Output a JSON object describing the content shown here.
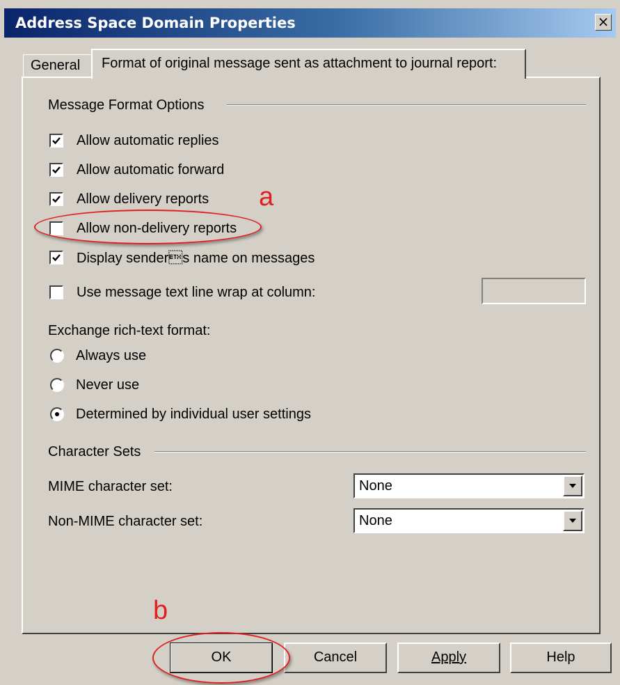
{
  "window": {
    "title": "Address Space Domain Properties",
    "close_glyph": "×"
  },
  "tabs": [
    {
      "label": "General",
      "active": false
    },
    {
      "label": "Format of original message sent as attachment to journal report:",
      "active": true
    }
  ],
  "message_format": {
    "group_label": "Message Format Options",
    "options": [
      {
        "label": "Allow automatic replies",
        "checked": true
      },
      {
        "label": "Allow automatic forward",
        "checked": true
      },
      {
        "label": "Allow delivery reports",
        "checked": true
      },
      {
        "label": "Allow non-delivery reports",
        "checked": false
      },
      {
        "label": "Display sender\u0003s name on messages",
        "checked": true
      },
      {
        "label": "Use message text line wrap at column:",
        "checked": false
      }
    ],
    "wrap_column_value": ""
  },
  "rich_text": {
    "label": "Exchange rich-text format:",
    "options": [
      {
        "label": "Always use",
        "selected": false
      },
      {
        "label": "Never use",
        "selected": false
      },
      {
        "label": "Determined by individual user settings",
        "selected": true
      }
    ]
  },
  "charsets": {
    "group_label": "Character Sets",
    "mime_label": "MIME character set:",
    "mime_value": "None",
    "non_mime_label": "Non-MIME character set:",
    "non_mime_value": "None"
  },
  "buttons": {
    "ok": "OK",
    "cancel": "Cancel",
    "apply": "Apply",
    "help": "Help"
  },
  "annotations": {
    "a": "a",
    "b": "b",
    "color": "#e02020"
  },
  "colors": {
    "dialog_bg": "#d4d0c8",
    "title_bar_start": "#0a246a",
    "title_bar_end": "#a6caf0"
  }
}
